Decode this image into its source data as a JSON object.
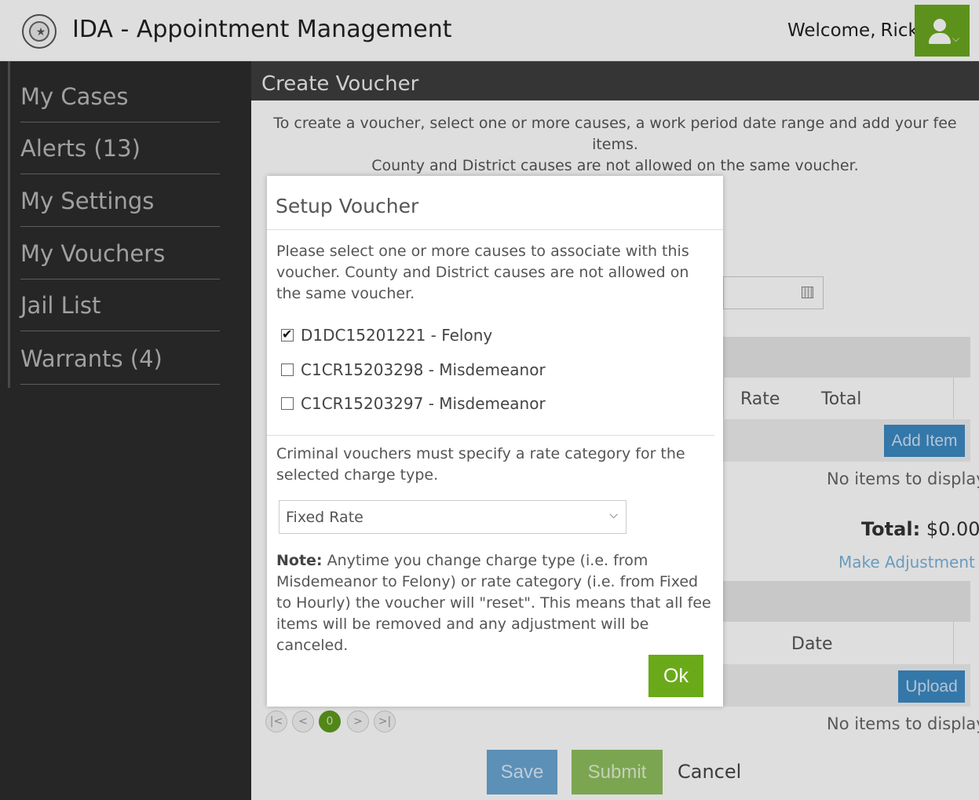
{
  "header": {
    "app_title": "IDA - Appointment Management",
    "welcome_label": "Welcome,",
    "user_name": "Rick"
  },
  "sidebar": {
    "items": [
      {
        "label": "My Cases"
      },
      {
        "label": "Alerts (13)"
      },
      {
        "label": "My Settings"
      },
      {
        "label": "My Vouchers"
      },
      {
        "label": "Jail List"
      },
      {
        "label": "Warrants (4)"
      }
    ]
  },
  "page": {
    "title": "Create Voucher",
    "intro_line1": "To create a voucher, select one or more causes, a work period date range and add your fee items.",
    "intro_line2": "County and District causes are not allowed on the same voucher."
  },
  "fees": {
    "col_rate": "Rate",
    "col_total": "Total",
    "add_item_label": "Add Item",
    "empty_text": "No items to display",
    "total_label": "Total:",
    "total_value": "$0.00",
    "adjust_label": "Make Adjustment"
  },
  "attachments": {
    "col_date": "Date",
    "upload_label": "Upload",
    "empty_text": "No items to display"
  },
  "pager": {
    "current_page": "0",
    "first_icon": "first-page-icon",
    "prev_icon": "prev-page-icon",
    "next_icon": "next-page-icon",
    "last_icon": "last-page-icon"
  },
  "footer": {
    "save_label": "Save",
    "submit_label": "Submit",
    "cancel_label": "Cancel"
  },
  "modal": {
    "title": "Setup Voucher",
    "instructions": "Please select one or more causes to associate with this voucher. County and District causes are not allowed on the same voucher.",
    "causes": [
      {
        "label": "D1DC15201221 - Felony",
        "checked": true
      },
      {
        "label": "C1CR15203298 - Misdemeanor",
        "checked": false
      },
      {
        "label": "C1CR15203297 - Misdemeanor",
        "checked": false
      }
    ],
    "rate_prompt": "Criminal vouchers must specify a rate category for the selected charge type.",
    "rate_selected": "Fixed Rate",
    "note_label": "Note:",
    "note_text": " Anytime you change charge type (i.e. from Misdemeanor to Felony) or rate category (i.e. from Fixed to Hourly) the voucher will \"reset\". This means that all fee items will be removed and any adjustment will be canceled.",
    "ok_label": "Ok"
  },
  "colors": {
    "brand_green": "#6aa81f",
    "sidebar_bg": "#2c2c2c",
    "header_bar_bg": "#3d3d3d",
    "button_blue": "#3c89c3"
  }
}
